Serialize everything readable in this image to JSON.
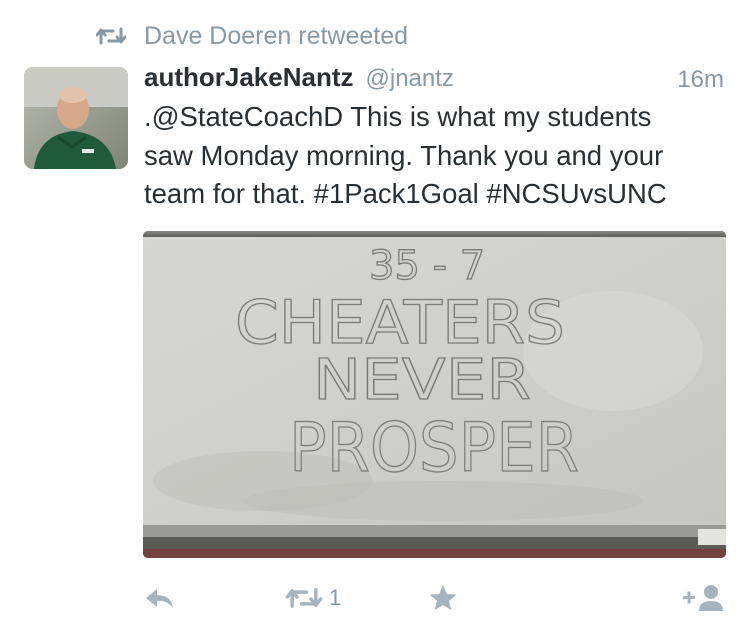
{
  "retweet_context": {
    "icon": "retweet-icon",
    "text": "Dave Doeren retweeted"
  },
  "tweet": {
    "author_name": "authorJakeNantz",
    "handle": "@jnantz",
    "timestamp": "16m",
    "text_lines": [
      ".@StateCoachD This is what my students",
      "saw Monday morning.  Thank you and your",
      "team for that.  #1Pack1Goal #NCSUvsUNC"
    ],
    "photo": {
      "whiteboard_lines": [
        "35 - 7",
        "CHEATERS",
        "NEVER",
        "PROSPER"
      ]
    }
  },
  "actions": {
    "reply": {
      "icon": "reply-icon"
    },
    "retweet": {
      "icon": "retweet-icon",
      "count": "1"
    },
    "favorite": {
      "icon": "star-icon"
    },
    "follow": {
      "icon": "add-user-icon"
    }
  },
  "colors": {
    "text": "#292f33",
    "muted": "#8899a6",
    "icon": "#a8b4bd"
  }
}
